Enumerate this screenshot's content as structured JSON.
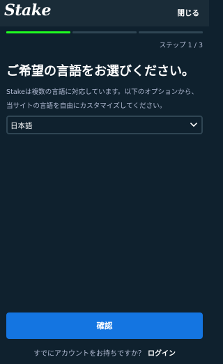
{
  "header": {
    "logo_text": "Stake",
    "close_label": "閉じる"
  },
  "progress": {
    "current_step": 1,
    "total_steps": 3,
    "step_text": "ステップ 1 / 3",
    "active_color": "#1fff20",
    "inactive_color": "#2f4553"
  },
  "main": {
    "title": "ご希望の言語をお選びください。",
    "description": "Stakeは複数の言語に対応しています。以下のオプションから、当サイトの言語を自由にカスタマイズしてください。",
    "language_select": {
      "selected_value": "日本語",
      "icon": "chevron-down-icon"
    }
  },
  "actions": {
    "confirm_label": "確認",
    "confirm_color": "#1475e1"
  },
  "footer": {
    "prompt_text": "すでにアカウントをお持ちですか？",
    "login_label": "ログイン"
  },
  "colors": {
    "background": "#0f212e",
    "header_background": "#1a2c38",
    "muted_text": "#b1bad3",
    "border": "#2f4553"
  }
}
